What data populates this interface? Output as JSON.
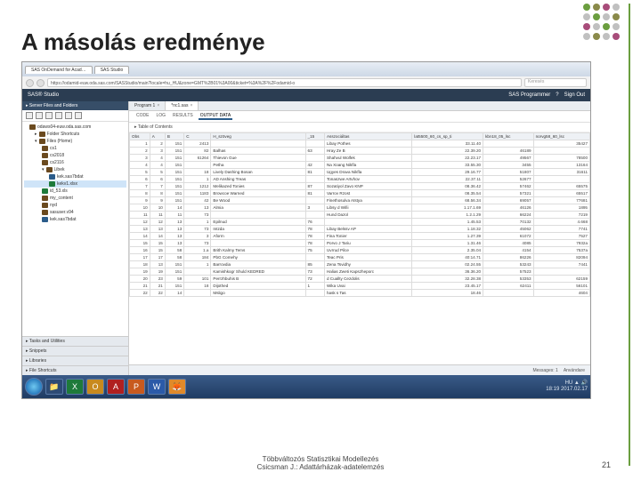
{
  "slide": {
    "title": "A másolás eredménye",
    "footer1": "Többváltozós Statisztikai Modellezés",
    "footer2": "Csicsman J.: Adattárházak-adatelemzés",
    "pagenum": "21"
  },
  "browser": {
    "tabs": [
      "SAS OnDemand for Acad…",
      "SAS Studio"
    ],
    "url": "https://odamid-euw.oda.sas.com/SASStudio/main?locale=hu_HU&zone=GMT%2B01%3A00&ticket=%3A%2F%2Fodamid-o",
    "search": "Keresés"
  },
  "sas": {
    "brand": "SAS® Studio",
    "programmer": "SAS Programmer",
    "signout": "Sign Out",
    "sidebar": {
      "hdr": "Server Files and Folders",
      "root": "odaws04-euw.oda.sas.com",
      "items": [
        "Folder Shortcuts",
        "Files (Home)",
        "cs1",
        "cs2018",
        "cs2116",
        "Libek",
        "kek.sas7bdat",
        "kekv1.xlsx",
        "id_53.xls",
        "my_content",
        "nyd",
        "sasuser.v94",
        "kek.sas7bdat"
      ],
      "sections": [
        "Tasks and Utilities",
        "Snippets",
        "Libraries",
        "File Shortcuts"
      ]
    },
    "main": {
      "tabs": [
        "Program 1",
        "*nc1.sas"
      ],
      "subtabs": [
        "CODE",
        "LOG",
        "RESULTS",
        "OUTPUT DATA"
      ],
      "toc": "Table of Contents",
      "cols": [
        "Obs",
        "A",
        "B",
        "C",
        "H_szöveg",
        "_15",
        "Asszociáltas",
        "lat5500_60_cs_sp_ti",
        "kbn18_05_lsc",
        "norvg58_60_lsc"
      ],
      "rows": [
        [
          "1",
          "2",
          "151",
          "2413",
          "",
          "",
          "Libay Pothes",
          "33.11.40",
          "",
          "35427"
        ],
        [
          "2",
          "3",
          "151",
          "82",
          "Balhas",
          "63",
          "Hray Ze B",
          "22.39.20",
          "46189",
          ""
        ],
        [
          "3",
          "4",
          "151",
          "61264",
          "Thievon Gue",
          "",
          "Shahvul Wolfek",
          "22.23.17",
          "49567",
          "78500"
        ],
        [
          "4",
          "4",
          "151",
          "",
          "Petha",
          "42",
          "Na Xoang Nikfla",
          "33.55.30",
          "3455",
          "13164"
        ],
        [
          "5",
          "5",
          "151",
          "18",
          "Lively Dashing Bosan",
          "81",
          "Ugyes Drava Nikfla",
          "29.16.77",
          "51807",
          "31611"
        ],
        [
          "6",
          "6",
          "151",
          "1",
          "AD Anshing Treas",
          "",
          "Tonaszwe Artvhov",
          "22.37.11",
          "52677",
          ""
        ],
        [
          "7",
          "7",
          "151",
          "1212",
          "Melikazed Tonies",
          "87",
          "Sozatiyol Zavo KNP",
          "08.36.42",
          "57462",
          "65575"
        ],
        [
          "8",
          "8",
          "151",
          "1183",
          "Browcoe Warned",
          "81",
          "Varrov Rzost",
          "08.35.54",
          "57321",
          "65517"
        ],
        [
          "9",
          "9",
          "151",
          "42",
          "Be Wood",
          "",
          "Finethosulva Atstya",
          "68.56.34",
          "69057",
          "77681"
        ],
        [
          "10",
          "10",
          "14",
          "13",
          "Almia",
          "3",
          "Libsy d Wifii",
          "1.17.1.69",
          "46126",
          "1895"
        ],
        [
          "11",
          "11",
          "11",
          "73",
          "",
          "",
          "Hund Dazol",
          "1.2.1.29",
          "66224",
          "7219"
        ],
        [
          "12",
          "12",
          "13",
          "1",
          "Epilnud",
          "76",
          "",
          "1.45.53",
          "70132",
          "4.668"
        ],
        [
          "13",
          "13",
          "13",
          "73",
          "Intzda",
          "78",
          "Libay Belssv AP",
          "1.18.32",
          "45062",
          "7741"
        ],
        [
          "14",
          "14",
          "13",
          "3",
          "Aform",
          "78",
          "Fina Tonier",
          "1.27.39",
          "61072",
          "7527"
        ],
        [
          "15",
          "15",
          "13",
          "73",
          "",
          "78",
          "Porvo J Tariu",
          "1.31.46",
          "4085",
          "7932a"
        ],
        [
          "16",
          "15",
          "58",
          "1.a",
          "Brith Kalrny Tems",
          "75",
          "Uvrrud Pilce",
          "2.35.04",
          "4154",
          "7537a"
        ],
        [
          "17",
          "17",
          "58",
          "184",
          "PbG Comehy",
          "",
          "Teac Pris",
          "40:14.71",
          "86226",
          "82094"
        ],
        [
          "18",
          "13",
          "151",
          "1",
          "Barrovdia",
          "85",
          "Zena Tsvidhy",
          "02.24.55",
          "53243",
          "7441"
        ],
        [
          "19",
          "19",
          "151",
          "",
          "Kamishkogr Shuld KEDRED",
          "73",
          "Halias Zweti Kapszheporc",
          "36.36.20",
          "57523",
          ""
        ],
        [
          "20",
          "23",
          "59",
          "101",
          "Perrzhbuhis B",
          "72",
          "d Cuallty Cezdolis",
          "32.28.38",
          "53353",
          "62159"
        ],
        [
          "21",
          "21",
          "151",
          "18",
          "Dijothed",
          "1",
          "Wika Uvai",
          "23.45.17",
          "62411",
          "56101"
        ],
        [
          "22",
          "22",
          "14",
          "",
          "Msligo",
          "",
          "hask s Tas",
          "18.46",
          "",
          "4604"
        ]
      ],
      "status": {
        "msgs": "Messages: 1",
        "user": "Användare"
      }
    }
  },
  "taskbar": {
    "time": "18:19",
    "date": "2017.02.17"
  }
}
